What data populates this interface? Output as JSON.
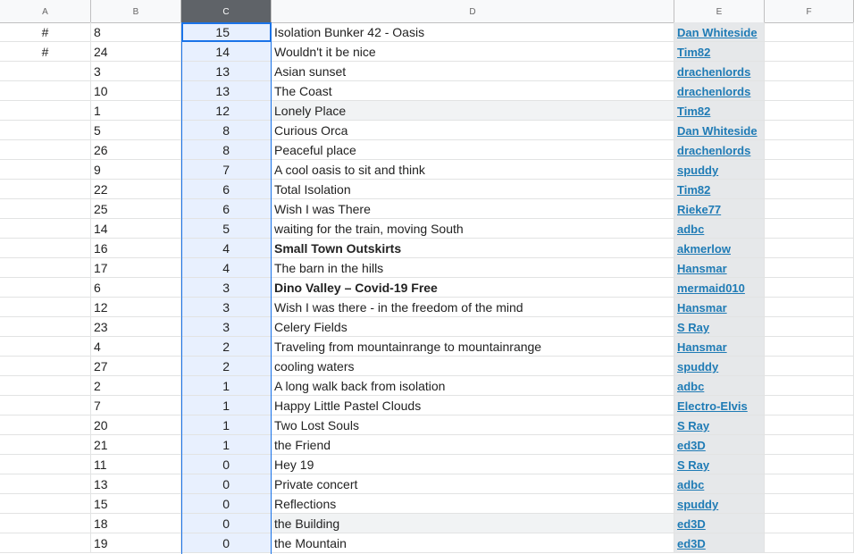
{
  "columns": [
    "A",
    "B",
    "C",
    "D",
    "E",
    "F"
  ],
  "rows": [
    {
      "a": "#",
      "b": "8",
      "c": "15",
      "d": "Isolation Bunker 42 - Oasis",
      "e": "Dan Whiteside",
      "bold": false
    },
    {
      "a": "#",
      "b": "24",
      "c": "14",
      "d": "Wouldn't it be nice",
      "e": "Tim82",
      "bold": false
    },
    {
      "a": "",
      "b": "3",
      "c": "13",
      "d": "Asian sunset",
      "e": "drachenlords",
      "bold": false
    },
    {
      "a": "",
      "b": "10",
      "c": "13",
      "d": "The Coast",
      "e": "drachenlords",
      "bold": false
    },
    {
      "a": "",
      "b": "1",
      "c": "12",
      "d": "Lonely Place",
      "e": "Tim82",
      "bold": false
    },
    {
      "a": "",
      "b": "5",
      "c": "8",
      "d": "Curious Orca",
      "e": "Dan Whiteside",
      "bold": false
    },
    {
      "a": "",
      "b": "26",
      "c": "8",
      "d": "Peaceful place",
      "e": "drachenlords",
      "bold": false
    },
    {
      "a": "",
      "b": "9",
      "c": "7",
      "d": "A cool oasis to sit and think",
      "e": "spuddy",
      "bold": false
    },
    {
      "a": "",
      "b": "22",
      "c": "6",
      "d": "Total Isolation",
      "e": "Tim82",
      "bold": false
    },
    {
      "a": "",
      "b": "25",
      "c": "6",
      "d": "Wish I was There",
      "e": "Rieke77",
      "bold": false
    },
    {
      "a": "",
      "b": "14",
      "c": "5",
      "d": "waiting for the train, moving South",
      "e": "adbc",
      "bold": false
    },
    {
      "a": "",
      "b": "16",
      "c": "4",
      "d": "Small Town Outskirts",
      "e": "akmerlow",
      "bold": true
    },
    {
      "a": "",
      "b": "17",
      "c": "4",
      "d": "The barn in the hills",
      "e": "Hansmar",
      "bold": false
    },
    {
      "a": "",
      "b": "6",
      "c": "3",
      "d": "Dino Valley – Covid-19 Free",
      "e": "mermaid010",
      "bold": true
    },
    {
      "a": "",
      "b": "12",
      "c": "3",
      "d": "Wish I was there - in the freedom of the mind",
      "e": "Hansmar",
      "bold": false
    },
    {
      "a": "",
      "b": "23",
      "c": "3",
      "d": "Celery Fields",
      "e": "S Ray",
      "bold": false
    },
    {
      "a": "",
      "b": "4",
      "c": "2",
      "d": "Traveling from mountainrange to mountainrange",
      "e": "Hansmar",
      "bold": false
    },
    {
      "a": "",
      "b": "27",
      "c": "2",
      "d": "cooling waters",
      "e": "spuddy",
      "bold": false
    },
    {
      "a": "",
      "b": "2",
      "c": "1",
      "d": "A long walk back from isolation",
      "e": "adbc",
      "bold": false
    },
    {
      "a": "",
      "b": "7",
      "c": "1",
      "d": "Happy Little Pastel Clouds",
      "e": "Electro-Elvis",
      "bold": false
    },
    {
      "a": "",
      "b": "20",
      "c": "1",
      "d": "Two Lost Souls",
      "e": "S Ray",
      "bold": false
    },
    {
      "a": "",
      "b": "21",
      "c": "1",
      "d": "the Friend",
      "e": "ed3D",
      "bold": false
    },
    {
      "a": "",
      "b": "11",
      "c": "0",
      "d": "Hey 19",
      "e": "S Ray",
      "bold": false
    },
    {
      "a": "",
      "b": "13",
      "c": "0",
      "d": "Private concert",
      "e": "adbc",
      "bold": false
    },
    {
      "a": "",
      "b": "15",
      "c": "0",
      "d": "Reflections",
      "e": "spuddy",
      "bold": false
    },
    {
      "a": "",
      "b": "18",
      "c": "0",
      "d": "the Building",
      "e": "ed3D",
      "bold": false
    },
    {
      "a": "",
      "b": "19",
      "c": "0",
      "d": "the Mountain",
      "e": "ed3D",
      "bold": false
    }
  ],
  "highlighted_rows": [
    4,
    25
  ],
  "colors": {
    "selection": "#1a73e8",
    "link": "#1f7bb5",
    "header_selected": "#5f6368"
  }
}
